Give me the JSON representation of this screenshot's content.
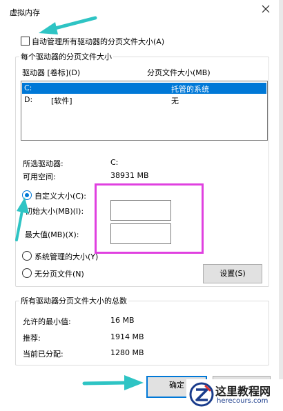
{
  "window": {
    "title": "虚拟内存"
  },
  "auto_manage": {
    "label": "自动管理所有驱动器的分页文件大小(A)",
    "checked": false
  },
  "per_drive": {
    "group_label": "每个驱动器的分页文件大小",
    "col_drive": "驱动器 [卷标](D)",
    "col_size": "分页文件大小(MB)",
    "drives": [
      {
        "drive": "C:",
        "label": "",
        "size": "托管的系统",
        "selected": true
      },
      {
        "drive": "D:",
        "label": "[软件]",
        "size": "无",
        "selected": false
      }
    ],
    "selected_drive_label": "所选驱动器:",
    "selected_drive_value": "C:",
    "free_space_label": "可用空间:",
    "free_space_value": "38931 MB",
    "custom_size_label": "自定义大小(C):",
    "initial_size_label": "初始大小(MB)(I):",
    "initial_size_value": "",
    "max_size_label": "最大值(MB)(X):",
    "max_size_value": "",
    "system_managed_label": "系统管理的大小(Y)",
    "no_paging_label": "无分页文件(N)",
    "set_button": "设置(S)"
  },
  "total": {
    "group_label": "所有驱动器分页文件大小的总数",
    "min_label": "允许的最小值:",
    "min_value": "16 MB",
    "recommended_label": "推荐:",
    "recommended_value": "1914 MB",
    "current_label": "当前已分配:",
    "current_value": "1280 MB"
  },
  "buttons": {
    "ok": "确定",
    "cancel": ""
  },
  "watermark": {
    "name": "这里教程网",
    "url": "herecours.com"
  },
  "colors": {
    "accent": "#0078d7",
    "highlight_box": "#e040e0",
    "arrow": "#2ec4c4"
  }
}
